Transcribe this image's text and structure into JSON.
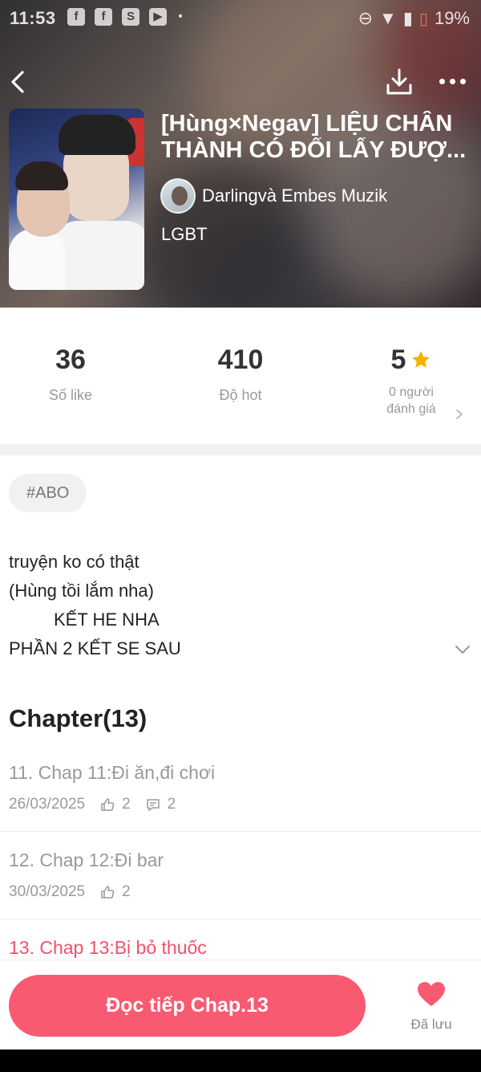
{
  "status_bar": {
    "time": "11:53",
    "notification_icons": [
      "facebook-icon",
      "facebook-icon",
      "shopee-icon",
      "play-icon",
      "dot-icon"
    ],
    "battery": "19%"
  },
  "colors": {
    "accent": "#f85a72",
    "current_chapter": "#f2506a",
    "star": "#f5b100"
  },
  "story": {
    "title_line1": "[Hùng×Negav] LIỆU CHÂN",
    "title_line2": "THÀNH CÓ ĐỔI LẤY ĐƯỢ...",
    "author": "Darlingvà Embes Muzik",
    "genre": "LGBT"
  },
  "stats": {
    "likes": "36",
    "likes_label": "Số like",
    "hot": "410",
    "hot_label": "Độ hot",
    "rating": "5",
    "rating_label_line1": "0 người",
    "rating_label_line2": "đánh giá"
  },
  "tags": [
    "#ABO"
  ],
  "description": {
    "line1": "truyện ko có thật",
    "line2": "(Hùng tồi lắm nha)",
    "line3": "KẾT HE NHA",
    "line4": "PHẦN 2 KẾT SE SAU"
  },
  "chapters_heading": "Chapter(13)",
  "chapters": [
    {
      "title": "11. Chap 11:Đi ăn,đi chơi",
      "date": "26/03/2025",
      "likes": "2",
      "comments": "2"
    },
    {
      "title": "12. Chap 12:Đi bar",
      "date": "30/03/2025",
      "likes": "2"
    },
    {
      "title": "13. Chap 13:Bị bỏ thuốc"
    }
  ],
  "bottom": {
    "read_button": "Đọc tiếp Chap.13",
    "saved_label": "Đã lưu"
  }
}
